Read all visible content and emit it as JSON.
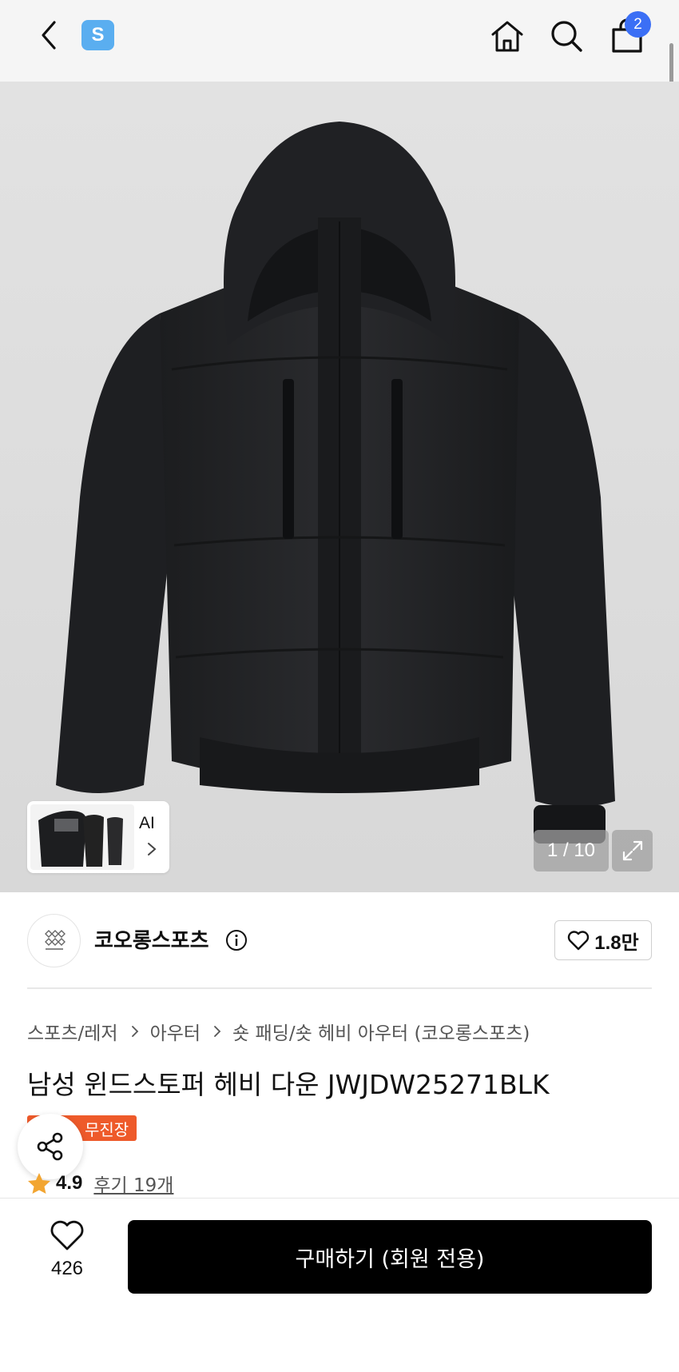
{
  "topbar": {
    "back_icon": "chevron-left-icon",
    "app_logo_letter": "S",
    "app_logo_color": "#5aaef0",
    "home_icon": "home-icon",
    "search_icon": "search-icon",
    "cart_icon": "shopping-bag-icon",
    "cart_count": "2",
    "badge_color": "#3b6ff5"
  },
  "gallery": {
    "thumb_label": "AI",
    "page_counter": "1 / 10",
    "expand_icon": "expand-icon"
  },
  "brand": {
    "name": "코오롱스포츠",
    "info_icon": "info-icon",
    "like_count": "1.8만"
  },
  "breadcrumb": [
    "스포츠/레저",
    "아우터",
    "숏 패딩/숏 헤비 아우터 (코오롱스포츠)"
  ],
  "product": {
    "title": "남성 윈드스토퍼 헤비 다운 JWJDW25271BLK",
    "promo_badge": "무진장",
    "promo_color": "#ee5a2a",
    "rating": "4.9",
    "review_link": "후기 19개"
  },
  "bottom_bar": {
    "wish_count": "426",
    "buy_label": "구매하기 (회원 전용)"
  }
}
